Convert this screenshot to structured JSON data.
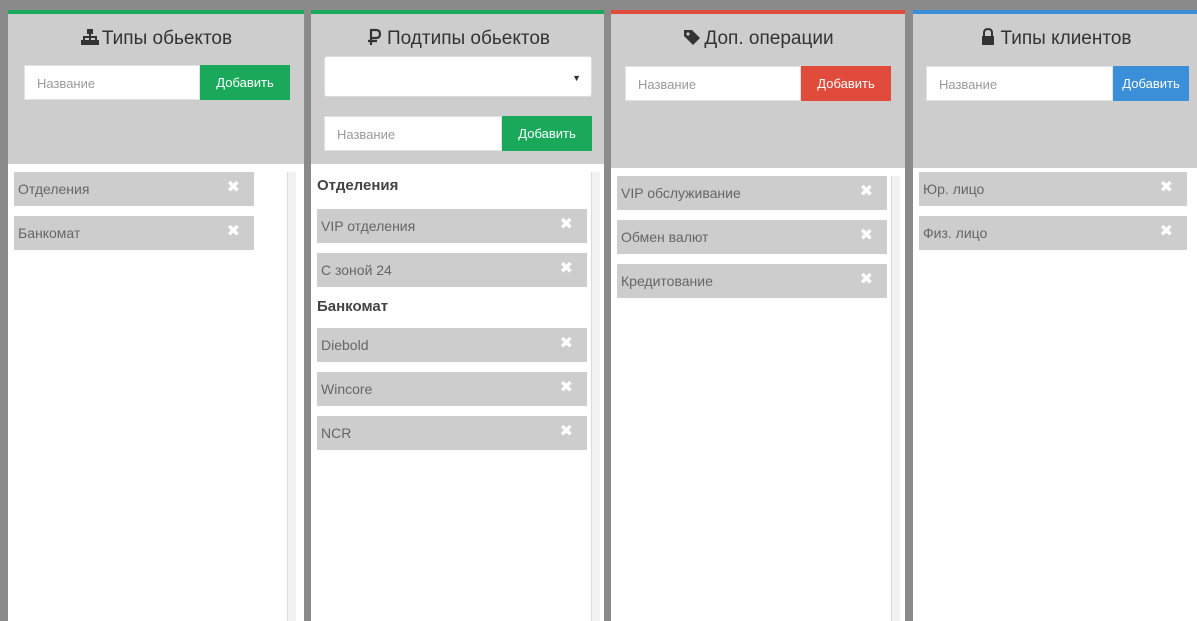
{
  "colors": {
    "green": "#1aa85b",
    "red": "#e14b3b",
    "blue": "#3a8fd8"
  },
  "object_types": {
    "title": "Типы обьектов",
    "icon": "sitemap-icon",
    "placeholder": "Название",
    "add_label": "Добавить",
    "items": [
      {
        "label": "Отделения"
      },
      {
        "label": "Банкомат"
      }
    ]
  },
  "object_subtypes": {
    "title": "Подтипы обьектов",
    "icon": "ruble-icon",
    "select_value": "",
    "placeholder": "Название",
    "add_label": "Добавить",
    "groups": [
      {
        "name": "Отделения",
        "items": [
          {
            "label": "VIP отделения"
          },
          {
            "label": "С зоной 24"
          }
        ]
      },
      {
        "name": "Банкомат",
        "items": [
          {
            "label": "Diebold"
          },
          {
            "label": "Wincore"
          },
          {
            "label": "NCR"
          }
        ]
      }
    ]
  },
  "extra_operations": {
    "title": "Доп. операции",
    "icon": "tag-icon",
    "placeholder": "Название",
    "add_label": "Добавить",
    "items": [
      {
        "label": "VIP обслуживание"
      },
      {
        "label": "Обмен валют"
      },
      {
        "label": "Кредитование"
      }
    ]
  },
  "client_types": {
    "title": "Типы клиентов",
    "icon": "lock-icon",
    "placeholder": "Название",
    "add_label": "Добавить",
    "items": [
      {
        "label": "Юр. лицо"
      },
      {
        "label": "Физ. лицо"
      }
    ]
  },
  "remove_glyph": "✖"
}
